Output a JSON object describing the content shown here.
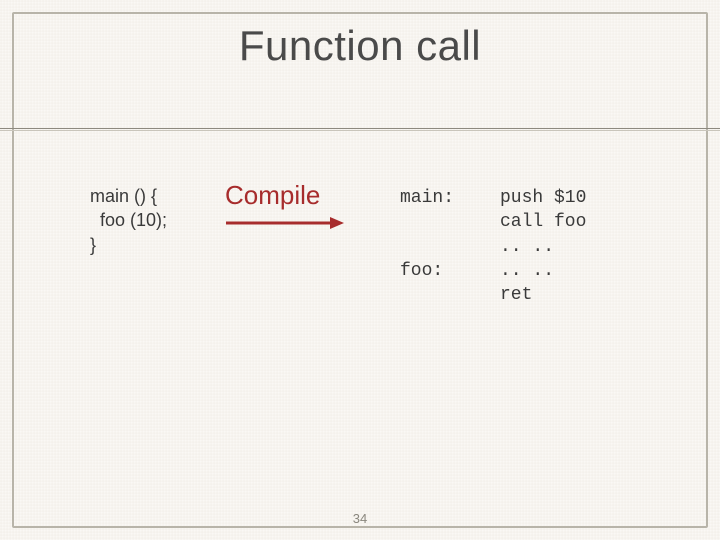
{
  "title": "Function call",
  "source_code": "main () {\n  foo (10);\n}",
  "compile_label": "Compile",
  "asm_labels": "main:\n\n\nfoo:",
  "asm_code": "push $10\ncall foo\n.. ..\n.. ..\nret",
  "page_number": "34",
  "colors": {
    "accent": "#a72c2c",
    "text": "#3a3a3a",
    "border": "#b8b4a9"
  }
}
